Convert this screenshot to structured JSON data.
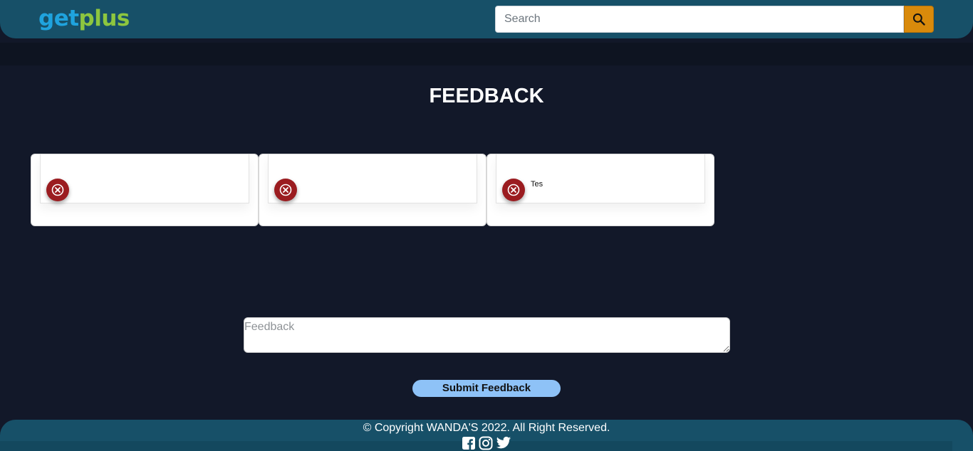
{
  "header": {
    "logo": {
      "part1": "get",
      "part2": "plus"
    },
    "search": {
      "placeholder": "Search",
      "value": ""
    },
    "search_button_icon": "search-icon"
  },
  "main": {
    "title": "FEEDBACK",
    "cards": [
      {
        "text": "",
        "delete_icon": "close-circle-icon"
      },
      {
        "text": "",
        "delete_icon": "close-circle-icon"
      },
      {
        "text": "Tes",
        "delete_icon": "close-circle-icon"
      }
    ],
    "feedback_input": {
      "placeholder": "Feedback",
      "value": ""
    },
    "submit_label": "Submit Feedback"
  },
  "footer": {
    "copyright": "© Copyright WANDA'S 2022. All Right Reserved.",
    "social": [
      "facebook-icon",
      "instagram-icon",
      "twitter-icon"
    ]
  },
  "colors": {
    "background": "#121829",
    "header": "#175068",
    "search_button": "#d98a0b",
    "delete_button": "#9b1c20",
    "submit_button": "#8ec2f7",
    "logo_get": "#1fa3de",
    "logo_plus": "#8dc63f"
  }
}
